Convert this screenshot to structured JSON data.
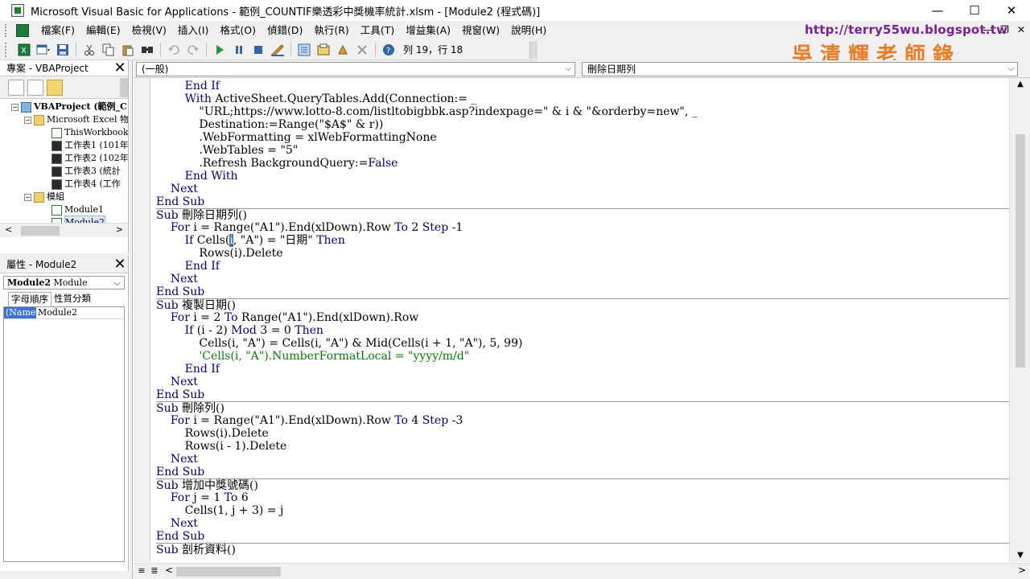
{
  "window": {
    "title": "Microsoft Visual Basic for Applications - 範例_COUNTIF樂透彩中獎機率統計.xlsm - [Module2 (程式碼)]",
    "minimize": "—",
    "maximize": "☐",
    "close": "✕"
  },
  "menu": {
    "items": [
      "檔案(F)",
      "編輯(E)",
      "檢視(V)",
      "插入(I)",
      "格式(O)",
      "偵錯(D)",
      "執行(R)",
      "工具(T)",
      "增益集(A)",
      "視窗(W)",
      "說明(H)"
    ],
    "mdi_minimize": "—",
    "mdi_restore": "❐",
    "mdi_close": "✕"
  },
  "toolbar": {
    "position_text": "列 19，行 18",
    "icons": [
      "excel-icon",
      "insert-icon",
      "save-icon",
      "cut-icon",
      "copy-icon",
      "paste-icon",
      "find-icon",
      "undo-icon",
      "redo-icon",
      "run-icon",
      "break-icon",
      "reset-icon",
      "design-icon",
      "project-explorer-icon",
      "properties-icon",
      "object-browser-icon",
      "toolbox-icon",
      "help-icon"
    ]
  },
  "watermark": {
    "url": "http://terry55wu.blogspot.tw",
    "name": "吳清輝老師錄製"
  },
  "project_pane": {
    "title": "專案 - VBAProject",
    "tree": {
      "project": "VBAProject (範例_C",
      "excel_objects": "Microsoft Excel 物",
      "this_workbook": "ThisWorkbook",
      "sheet1": "工作表1 (101年",
      "sheet2": "工作表2 (102年",
      "sheet3": "工作表3 (統計",
      "sheet4": "工作表4 (工作",
      "modules": "模組",
      "module1": "Module1",
      "module2": "Module2"
    }
  },
  "props_pane": {
    "title": "屬性 - Module2",
    "object": "Module2",
    "object_type": "Module",
    "tab_alpha": "字母順序",
    "tab_category": "性質分類",
    "prop_name": "(Name)",
    "prop_value": "Module2"
  },
  "code_window": {
    "object_combo": "(一般)",
    "proc_combo": "刪除日期列"
  },
  "code": [
    {
      "indent": "        ",
      "parts": [
        {
          "t": "End If",
          "c": "kw"
        }
      ]
    },
    {
      "indent": "        ",
      "parts": [
        {
          "t": "With",
          "c": "kw"
        },
        {
          "t": " ActiveSheet.QueryTables.Add(Connection:= _"
        }
      ]
    },
    {
      "indent": "            ",
      "parts": [
        {
          "t": "\"URL;https://www.lotto-8.com/listltobigbbk.asp?indexpage=\" & i & \"&orderby=new\", _"
        }
      ]
    },
    {
      "indent": "            ",
      "parts": [
        {
          "t": "Destination:=Range(\"$A$\" & r))"
        }
      ]
    },
    {
      "indent": "            ",
      "parts": [
        {
          "t": ".WebFormatting = xlWebFormattingNone"
        }
      ]
    },
    {
      "indent": "            ",
      "parts": [
        {
          "t": ".WebTables = \"5\""
        }
      ]
    },
    {
      "indent": "            ",
      "parts": [
        {
          "t": ".Refresh BackgroundQuery:="
        },
        {
          "t": "False",
          "c": "kw"
        }
      ]
    },
    {
      "indent": "        ",
      "parts": [
        {
          "t": "End With",
          "c": "kw"
        }
      ]
    },
    {
      "indent": "    ",
      "parts": [
        {
          "t": "Next",
          "c": "kw"
        }
      ]
    },
    {
      "indent": "",
      "parts": [
        {
          "t": "End Sub",
          "c": "kw"
        }
      ]
    },
    {
      "indent": "",
      "sep": true,
      "parts": [
        {
          "t": "Sub",
          "c": "kw"
        },
        {
          "t": " 刪除日期列()"
        }
      ]
    },
    {
      "indent": "    ",
      "parts": [
        {
          "t": "For",
          "c": "kw"
        },
        {
          "t": " i = Range(\"A1\").End(xlDown).Row "
        },
        {
          "t": "To",
          "c": "kw"
        },
        {
          "t": " 2 "
        },
        {
          "t": "Step",
          "c": "kw"
        },
        {
          "t": " -1"
        }
      ]
    },
    {
      "indent": "        ",
      "parts": [
        {
          "t": "If",
          "c": "kw"
        },
        {
          "t": " Cells("
        },
        {
          "t": "i",
          "c": "sel"
        },
        {
          "t": ", \"A\") = \"日期\" "
        },
        {
          "t": "Then",
          "c": "kw"
        }
      ]
    },
    {
      "indent": "            ",
      "parts": [
        {
          "t": "Rows(i).Delete"
        }
      ]
    },
    {
      "indent": "        ",
      "parts": [
        {
          "t": "End If",
          "c": "kw"
        }
      ]
    },
    {
      "indent": "    ",
      "parts": [
        {
          "t": "Next",
          "c": "kw"
        }
      ]
    },
    {
      "indent": "",
      "parts": [
        {
          "t": "End Sub",
          "c": "kw"
        }
      ]
    },
    {
      "indent": "",
      "sep": true,
      "parts": [
        {
          "t": "Sub",
          "c": "kw"
        },
        {
          "t": " 複製日期()"
        }
      ]
    },
    {
      "indent": "    ",
      "parts": [
        {
          "t": "For",
          "c": "kw"
        },
        {
          "t": " i = 2 "
        },
        {
          "t": "To",
          "c": "kw"
        },
        {
          "t": " Range(\"A1\").End(xlDown).Row"
        }
      ]
    },
    {
      "indent": "        ",
      "parts": [
        {
          "t": "If",
          "c": "kw"
        },
        {
          "t": " (i - 2) "
        },
        {
          "t": "Mod",
          "c": "kw"
        },
        {
          "t": " 3 = 0 "
        },
        {
          "t": "Then",
          "c": "kw"
        }
      ]
    },
    {
      "indent": "            ",
      "parts": [
        {
          "t": "Cells(i, \"A\") = Cells(i, \"A\") & Mid(Cells(i + 1, \"A\"), 5, 99)"
        }
      ]
    },
    {
      "indent": "            ",
      "parts": [
        {
          "t": "'Cells(i, \"A\").NumberFormatLocal = \"yyyy/m/d\"",
          "c": "cm"
        }
      ]
    },
    {
      "indent": "        ",
      "parts": [
        {
          "t": "End If",
          "c": "kw"
        }
      ]
    },
    {
      "indent": "    ",
      "parts": [
        {
          "t": "Next",
          "c": "kw"
        }
      ]
    },
    {
      "indent": "",
      "parts": [
        {
          "t": "End Sub",
          "c": "kw"
        }
      ]
    },
    {
      "indent": "",
      "sep": true,
      "parts": [
        {
          "t": "Sub",
          "c": "kw"
        },
        {
          "t": " 刪除列()"
        }
      ]
    },
    {
      "indent": "    ",
      "parts": [
        {
          "t": "For",
          "c": "kw"
        },
        {
          "t": " i = Range(\"A1\").End(xlDown).Row "
        },
        {
          "t": "To",
          "c": "kw"
        },
        {
          "t": " 4 "
        },
        {
          "t": "Step",
          "c": "kw"
        },
        {
          "t": " -3"
        }
      ]
    },
    {
      "indent": "        ",
      "parts": [
        {
          "t": "Rows(i).Delete"
        }
      ]
    },
    {
      "indent": "        ",
      "parts": [
        {
          "t": "Rows(i - 1).Delete"
        }
      ]
    },
    {
      "indent": "    ",
      "parts": [
        {
          "t": "Next",
          "c": "kw"
        }
      ]
    },
    {
      "indent": "",
      "parts": [
        {
          "t": "End Sub",
          "c": "kw"
        }
      ]
    },
    {
      "indent": "",
      "sep": true,
      "parts": [
        {
          "t": "Sub",
          "c": "kw"
        },
        {
          "t": " 增加中獎號碼()"
        }
      ]
    },
    {
      "indent": "    ",
      "parts": [
        {
          "t": "For",
          "c": "kw"
        },
        {
          "t": " j = 1 "
        },
        {
          "t": "To",
          "c": "kw"
        },
        {
          "t": " 6"
        }
      ]
    },
    {
      "indent": "        ",
      "parts": [
        {
          "t": "Cells(1, j + 3) = j"
        }
      ]
    },
    {
      "indent": "    ",
      "parts": [
        {
          "t": "Next",
          "c": "kw"
        }
      ]
    },
    {
      "indent": "",
      "parts": [
        {
          "t": "End Sub",
          "c": "kw"
        }
      ]
    },
    {
      "indent": "",
      "sep": true,
      "parts": [
        {
          "t": "Sub",
          "c": "kw"
        },
        {
          "t": " 剖析資料()"
        }
      ]
    }
  ],
  "colors": {
    "keyword": "#00007f",
    "comment": "#007f00",
    "selection": "#3a6fc4",
    "watermark_url": "#7b1f9a",
    "watermark_name": "#f07b1f"
  }
}
